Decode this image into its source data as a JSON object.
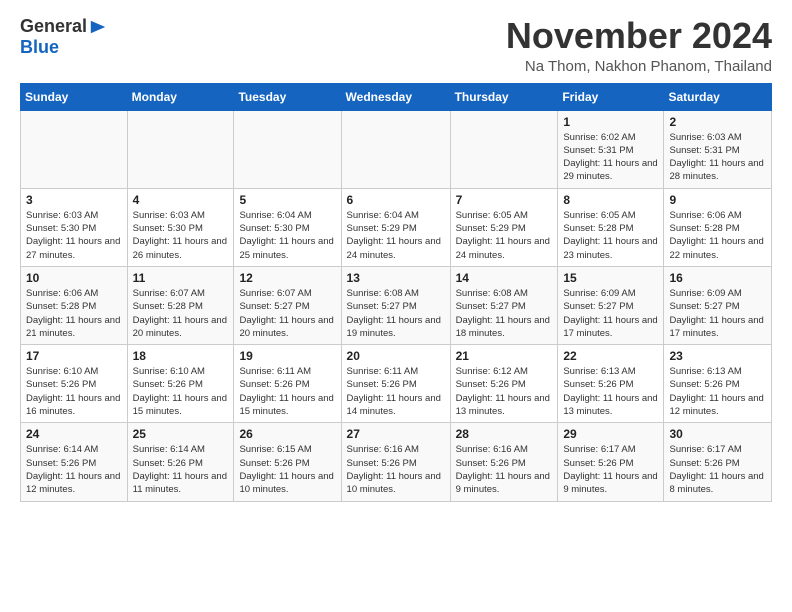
{
  "header": {
    "logo_general": "General",
    "logo_blue": "Blue",
    "month_title": "November 2024",
    "location": "Na Thom, Nakhon Phanom, Thailand"
  },
  "days_of_week": [
    "Sunday",
    "Monday",
    "Tuesday",
    "Wednesday",
    "Thursday",
    "Friday",
    "Saturday"
  ],
  "weeks": [
    [
      {
        "day": "",
        "info": ""
      },
      {
        "day": "",
        "info": ""
      },
      {
        "day": "",
        "info": ""
      },
      {
        "day": "",
        "info": ""
      },
      {
        "day": "",
        "info": ""
      },
      {
        "day": "1",
        "info": "Sunrise: 6:02 AM\nSunset: 5:31 PM\nDaylight: 11 hours and 29 minutes."
      },
      {
        "day": "2",
        "info": "Sunrise: 6:03 AM\nSunset: 5:31 PM\nDaylight: 11 hours and 28 minutes."
      }
    ],
    [
      {
        "day": "3",
        "info": "Sunrise: 6:03 AM\nSunset: 5:30 PM\nDaylight: 11 hours and 27 minutes."
      },
      {
        "day": "4",
        "info": "Sunrise: 6:03 AM\nSunset: 5:30 PM\nDaylight: 11 hours and 26 minutes."
      },
      {
        "day": "5",
        "info": "Sunrise: 6:04 AM\nSunset: 5:30 PM\nDaylight: 11 hours and 25 minutes."
      },
      {
        "day": "6",
        "info": "Sunrise: 6:04 AM\nSunset: 5:29 PM\nDaylight: 11 hours and 24 minutes."
      },
      {
        "day": "7",
        "info": "Sunrise: 6:05 AM\nSunset: 5:29 PM\nDaylight: 11 hours and 24 minutes."
      },
      {
        "day": "8",
        "info": "Sunrise: 6:05 AM\nSunset: 5:28 PM\nDaylight: 11 hours and 23 minutes."
      },
      {
        "day": "9",
        "info": "Sunrise: 6:06 AM\nSunset: 5:28 PM\nDaylight: 11 hours and 22 minutes."
      }
    ],
    [
      {
        "day": "10",
        "info": "Sunrise: 6:06 AM\nSunset: 5:28 PM\nDaylight: 11 hours and 21 minutes."
      },
      {
        "day": "11",
        "info": "Sunrise: 6:07 AM\nSunset: 5:28 PM\nDaylight: 11 hours and 20 minutes."
      },
      {
        "day": "12",
        "info": "Sunrise: 6:07 AM\nSunset: 5:27 PM\nDaylight: 11 hours and 20 minutes."
      },
      {
        "day": "13",
        "info": "Sunrise: 6:08 AM\nSunset: 5:27 PM\nDaylight: 11 hours and 19 minutes."
      },
      {
        "day": "14",
        "info": "Sunrise: 6:08 AM\nSunset: 5:27 PM\nDaylight: 11 hours and 18 minutes."
      },
      {
        "day": "15",
        "info": "Sunrise: 6:09 AM\nSunset: 5:27 PM\nDaylight: 11 hours and 17 minutes."
      },
      {
        "day": "16",
        "info": "Sunrise: 6:09 AM\nSunset: 5:27 PM\nDaylight: 11 hours and 17 minutes."
      }
    ],
    [
      {
        "day": "17",
        "info": "Sunrise: 6:10 AM\nSunset: 5:26 PM\nDaylight: 11 hours and 16 minutes."
      },
      {
        "day": "18",
        "info": "Sunrise: 6:10 AM\nSunset: 5:26 PM\nDaylight: 11 hours and 15 minutes."
      },
      {
        "day": "19",
        "info": "Sunrise: 6:11 AM\nSunset: 5:26 PM\nDaylight: 11 hours and 15 minutes."
      },
      {
        "day": "20",
        "info": "Sunrise: 6:11 AM\nSunset: 5:26 PM\nDaylight: 11 hours and 14 minutes."
      },
      {
        "day": "21",
        "info": "Sunrise: 6:12 AM\nSunset: 5:26 PM\nDaylight: 11 hours and 13 minutes."
      },
      {
        "day": "22",
        "info": "Sunrise: 6:13 AM\nSunset: 5:26 PM\nDaylight: 11 hours and 13 minutes."
      },
      {
        "day": "23",
        "info": "Sunrise: 6:13 AM\nSunset: 5:26 PM\nDaylight: 11 hours and 12 minutes."
      }
    ],
    [
      {
        "day": "24",
        "info": "Sunrise: 6:14 AM\nSunset: 5:26 PM\nDaylight: 11 hours and 12 minutes."
      },
      {
        "day": "25",
        "info": "Sunrise: 6:14 AM\nSunset: 5:26 PM\nDaylight: 11 hours and 11 minutes."
      },
      {
        "day": "26",
        "info": "Sunrise: 6:15 AM\nSunset: 5:26 PM\nDaylight: 11 hours and 10 minutes."
      },
      {
        "day": "27",
        "info": "Sunrise: 6:16 AM\nSunset: 5:26 PM\nDaylight: 11 hours and 10 minutes."
      },
      {
        "day": "28",
        "info": "Sunrise: 6:16 AM\nSunset: 5:26 PM\nDaylight: 11 hours and 9 minutes."
      },
      {
        "day": "29",
        "info": "Sunrise: 6:17 AM\nSunset: 5:26 PM\nDaylight: 11 hours and 9 minutes."
      },
      {
        "day": "30",
        "info": "Sunrise: 6:17 AM\nSunset: 5:26 PM\nDaylight: 11 hours and 8 minutes."
      }
    ]
  ]
}
